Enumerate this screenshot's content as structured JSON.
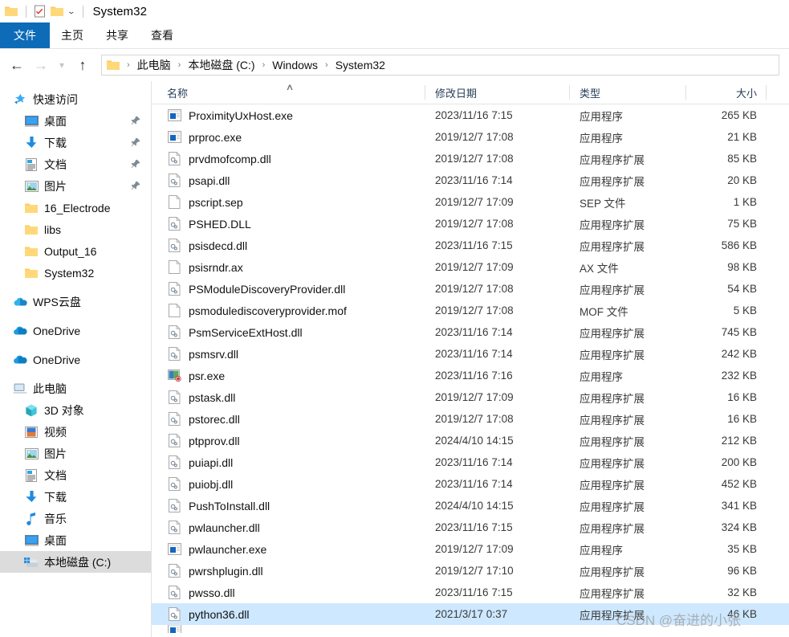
{
  "window": {
    "title": "System32",
    "quick_access_icons": [
      "folder-icon",
      "properties-checklist-icon",
      "new-folder-icon"
    ],
    "customize_caret": "⌄"
  },
  "ribbon": {
    "tabs": [
      {
        "label": "文件",
        "active": true
      },
      {
        "label": "主页",
        "active": false
      },
      {
        "label": "共享",
        "active": false
      },
      {
        "label": "查看",
        "active": false
      }
    ],
    "accent_color": "#0d6bb8"
  },
  "navigation": {
    "back_icon": "arrow-left-icon",
    "forward_icon": "arrow-right-icon",
    "recent_icon": "chevron-down-icon",
    "up_icon": "arrow-up-icon",
    "breadcrumb": [
      "此电脑",
      "本地磁盘 (C:)",
      "Windows",
      "System32"
    ],
    "separator": "›"
  },
  "sidebar": {
    "groups": [
      {
        "header": {
          "label": "快速访问",
          "icon": "star-pin-icon",
          "level": 0
        },
        "items": [
          {
            "label": "桌面",
            "icon": "desktop-icon",
            "pinned": true,
            "level": 1
          },
          {
            "label": "下载",
            "icon": "download-icon",
            "pinned": true,
            "level": 1
          },
          {
            "label": "文档",
            "icon": "documents-icon",
            "pinned": true,
            "level": 1
          },
          {
            "label": "图片",
            "icon": "pictures-icon",
            "pinned": true,
            "level": 1
          },
          {
            "label": "16_Electrode",
            "icon": "folder-icon",
            "pinned": false,
            "level": 1
          },
          {
            "label": "libs",
            "icon": "folder-icon",
            "pinned": false,
            "level": 1
          },
          {
            "label": "Output_16",
            "icon": "folder-icon",
            "pinned": false,
            "level": 1
          },
          {
            "label": "System32",
            "icon": "folder-icon",
            "pinned": false,
            "level": 1
          }
        ]
      },
      {
        "header": null,
        "items": [
          {
            "label": "WPS云盘",
            "icon": "wps-cloud-icon",
            "pinned": false,
            "level": 0
          }
        ]
      },
      {
        "header": null,
        "items": [
          {
            "label": "OneDrive",
            "icon": "onedrive-icon",
            "pinned": false,
            "level": 0
          }
        ]
      },
      {
        "header": null,
        "items": [
          {
            "label": "OneDrive",
            "icon": "onedrive-icon",
            "pinned": false,
            "level": 0
          }
        ]
      },
      {
        "header": {
          "label": "此电脑",
          "icon": "this-pc-icon",
          "level": 0
        },
        "items": [
          {
            "label": "3D 对象",
            "icon": "3d-objects-icon",
            "pinned": false,
            "level": 1
          },
          {
            "label": "视频",
            "icon": "videos-icon",
            "pinned": false,
            "level": 1
          },
          {
            "label": "图片",
            "icon": "pictures-icon",
            "pinned": false,
            "level": 1
          },
          {
            "label": "文档",
            "icon": "documents-icon",
            "pinned": false,
            "level": 1
          },
          {
            "label": "下载",
            "icon": "download-icon",
            "pinned": false,
            "level": 1
          },
          {
            "label": "音乐",
            "icon": "music-icon",
            "pinned": false,
            "level": 1
          },
          {
            "label": "桌面",
            "icon": "desktop-icon",
            "pinned": false,
            "level": 1
          },
          {
            "label": "本地磁盘 (C:)",
            "icon": "local-disk-icon",
            "pinned": false,
            "level": 1,
            "selected": true
          }
        ]
      }
    ]
  },
  "file_list": {
    "columns": [
      {
        "key": "name",
        "label": "名称",
        "sorted": "asc",
        "sort_caret": "∧"
      },
      {
        "key": "date",
        "label": "修改日期"
      },
      {
        "key": "type",
        "label": "类型"
      },
      {
        "key": "size",
        "label": "大小"
      }
    ],
    "rows": [
      {
        "name": "ProximityUxHost.exe",
        "icon": "exe-icon",
        "date": "2023/11/16 7:15",
        "type": "应用程序",
        "size": "265 KB"
      },
      {
        "name": "prproc.exe",
        "icon": "exe-icon",
        "date": "2019/12/7 17:08",
        "type": "应用程序",
        "size": "21 KB"
      },
      {
        "name": "prvdmofcomp.dll",
        "icon": "dll-icon",
        "date": "2019/12/7 17:08",
        "type": "应用程序扩展",
        "size": "85 KB"
      },
      {
        "name": "psapi.dll",
        "icon": "dll-icon",
        "date": "2023/11/16 7:14",
        "type": "应用程序扩展",
        "size": "20 KB"
      },
      {
        "name": "pscript.sep",
        "icon": "generic-file-icon",
        "date": "2019/12/7 17:09",
        "type": "SEP 文件",
        "size": "1 KB"
      },
      {
        "name": "PSHED.DLL",
        "icon": "dll-icon",
        "date": "2019/12/7 17:08",
        "type": "应用程序扩展",
        "size": "75 KB"
      },
      {
        "name": "psisdecd.dll",
        "icon": "dll-icon",
        "date": "2023/11/16 7:15",
        "type": "应用程序扩展",
        "size": "586 KB"
      },
      {
        "name": "psisrndr.ax",
        "icon": "generic-file-icon",
        "date": "2019/12/7 17:09",
        "type": "AX 文件",
        "size": "98 KB"
      },
      {
        "name": "PSModuleDiscoveryProvider.dll",
        "icon": "dll-icon",
        "date": "2019/12/7 17:08",
        "type": "应用程序扩展",
        "size": "54 KB"
      },
      {
        "name": "psmodulediscoveryprovider.mof",
        "icon": "generic-file-icon",
        "date": "2019/12/7 17:08",
        "type": "MOF 文件",
        "size": "5 KB"
      },
      {
        "name": "PsmServiceExtHost.dll",
        "icon": "dll-icon",
        "date": "2023/11/16 7:14",
        "type": "应用程序扩展",
        "size": "745 KB"
      },
      {
        "name": "psmsrv.dll",
        "icon": "dll-icon",
        "date": "2023/11/16 7:14",
        "type": "应用程序扩展",
        "size": "242 KB"
      },
      {
        "name": "psr.exe",
        "icon": "psr-exe-icon",
        "date": "2023/11/16 7:16",
        "type": "应用程序",
        "size": "232 KB"
      },
      {
        "name": "pstask.dll",
        "icon": "dll-icon",
        "date": "2019/12/7 17:09",
        "type": "应用程序扩展",
        "size": "16 KB"
      },
      {
        "name": "pstorec.dll",
        "icon": "dll-icon",
        "date": "2019/12/7 17:08",
        "type": "应用程序扩展",
        "size": "16 KB"
      },
      {
        "name": "ptpprov.dll",
        "icon": "dll-icon",
        "date": "2024/4/10 14:15",
        "type": "应用程序扩展",
        "size": "212 KB"
      },
      {
        "name": "puiapi.dll",
        "icon": "dll-icon",
        "date": "2023/11/16 7:14",
        "type": "应用程序扩展",
        "size": "200 KB"
      },
      {
        "name": "puiobj.dll",
        "icon": "dll-icon",
        "date": "2023/11/16 7:14",
        "type": "应用程序扩展",
        "size": "452 KB"
      },
      {
        "name": "PushToInstall.dll",
        "icon": "dll-icon",
        "date": "2024/4/10 14:15",
        "type": "应用程序扩展",
        "size": "341 KB"
      },
      {
        "name": "pwlauncher.dll",
        "icon": "dll-icon",
        "date": "2023/11/16 7:15",
        "type": "应用程序扩展",
        "size": "324 KB"
      },
      {
        "name": "pwlauncher.exe",
        "icon": "exe-icon",
        "date": "2019/12/7 17:09",
        "type": "应用程序",
        "size": "35 KB"
      },
      {
        "name": "pwrshplugin.dll",
        "icon": "dll-icon",
        "date": "2019/12/7 17:10",
        "type": "应用程序扩展",
        "size": "96 KB"
      },
      {
        "name": "pwsso.dll",
        "icon": "dll-icon",
        "date": "2023/11/16 7:15",
        "type": "应用程序扩展",
        "size": "32 KB"
      },
      {
        "name": "python36.dll",
        "icon": "dll-icon",
        "date": "2021/3/17 0:37",
        "type": "应用程序扩展",
        "size": "46 KB",
        "selected": true
      }
    ],
    "selection_color": "#cde8ff"
  },
  "watermark": {
    "text": "CSDN @奋进的小张"
  }
}
